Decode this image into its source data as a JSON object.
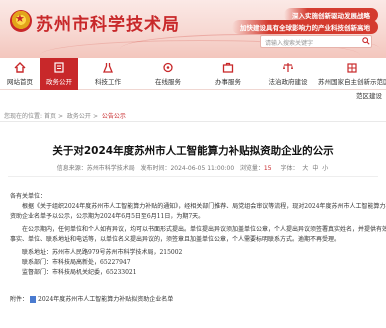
{
  "header": {
    "site_title": "苏州市科学技术局",
    "slogan_1": "深入实施创新驱动发展战略",
    "slogan_2": "加快建设具有全球影响力的产业科技创新高地",
    "search_placeholder": "请输入搜索关键字"
  },
  "nav": {
    "items": [
      {
        "label": "网站首页",
        "icon": "home-icon"
      },
      {
        "label": "政务公开",
        "icon": "document-icon"
      },
      {
        "label": "科技工作",
        "icon": "flask-icon"
      },
      {
        "label": "在线服务",
        "icon": "service-icon"
      },
      {
        "label": "办事服务",
        "icon": "briefcase-icon"
      },
      {
        "label": "法治政府建设",
        "icon": "scale-icon"
      },
      {
        "label": "苏州国家自主创新示范区",
        "icon": "building-icon"
      }
    ],
    "active_index": 1,
    "sub_label": "范区建设",
    "active_color": "#c8282a"
  },
  "breadcrumb": {
    "prefix": "您现在的位置:",
    "items": [
      "首页",
      "政务公开",
      "公告公示"
    ]
  },
  "article": {
    "title": "关于对2024年度苏州市人工智能算力补贴拟资助企业的公示",
    "source_label": "信息来源：苏州市科学技术局",
    "date_label": "发布时间：2024-06-05 11:00:00",
    "views_label": "浏览量：",
    "views": "15",
    "font_label": "字体：",
    "font_sizes": [
      "大",
      "中",
      "小"
    ],
    "greeting": "各有关单位：",
    "p1_line1": "根据《关于组织2024年度苏州市人工智能算力补贴的通知》，经相关部门推荐、局党组会审议等流程，现对2024年度苏州市人工智能算力补贴拟",
    "p1_line2": "资助企业名单予以公示，公示期为2024年6月5日至6月11日，为期7天。",
    "p2_line1": "在公示期内，任何单位和个人如有异议，均可以书面形式提出。单位提出异议须加盖单位公章，个人提出异议须签署真实姓名，并提供有效的",
    "p2_line2": "事实、单位、联系地址和电话等，以单位名义提出异议的，须签章且加盖单位公章，个人需要标明联系方式。逾期不再受理。",
    "contact_intro": "联系地址：苏州市人民路979号苏州市科学技术局，215002",
    "contact_1": "联系部门：市科技局高新处，65227947",
    "contact_2": "监督部门：市科技局机关纪委，65233021",
    "attach_label": "附件：",
    "attach_name": "2024年度苏州市人工智能算力补贴拟资助企业名单"
  }
}
